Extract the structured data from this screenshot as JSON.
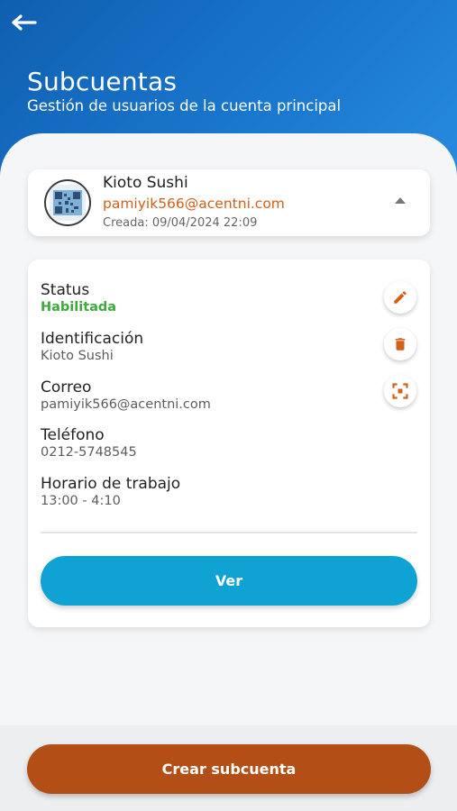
{
  "header": {
    "back_icon": "arrow-left-icon",
    "title": "Subcuentas",
    "subtitle": "Gestión de usuarios de la cuenta principal"
  },
  "account": {
    "avatar_icon": "qr-code-icon",
    "name": "Kioto Sushi",
    "email": "pamiyik566@acentni.com",
    "created": "Creada: 09/04/2024 22:09",
    "expand_icon": "caret-up-icon"
  },
  "details": {
    "status_label": "Status",
    "status_value": "Habilitada",
    "id_label": "Identificación",
    "id_value": "Kioto Sushi",
    "email_label": "Correo",
    "email_value": "pamiyik566@acentni.com",
    "phone_label": "Teléfono",
    "phone_value": "0212-5748545",
    "hours_label": "Horario de trabajo",
    "hours_value": "13:00 - 4:10",
    "actions": [
      "edit-icon",
      "delete-icon",
      "scan-icon"
    ]
  },
  "buttons": {
    "view_label": "Ver",
    "create_label": "Crear subcuenta"
  },
  "colors": {
    "header_blue": "#1a78cf",
    "accent_orange": "#d2601a",
    "status_green": "#3dab3c",
    "view_button": "#0fa3d4",
    "create_button": "#b24e16"
  }
}
